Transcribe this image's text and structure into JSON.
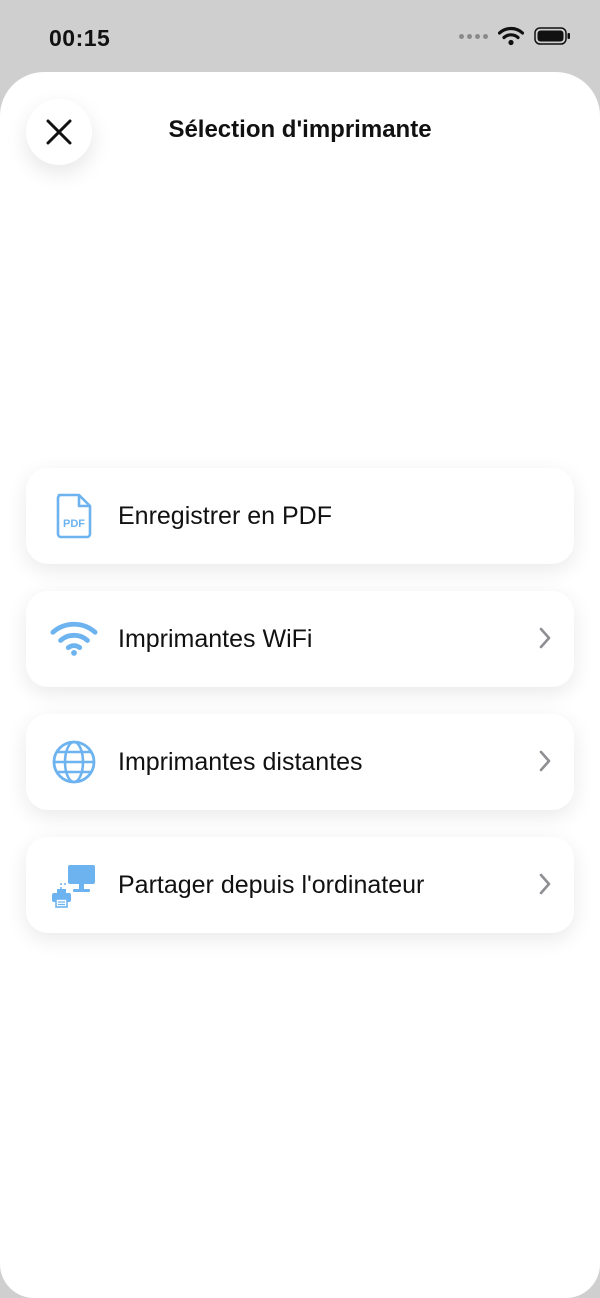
{
  "status_bar": {
    "time": "00:15"
  },
  "sheet": {
    "title": "Sélection d'imprimante",
    "close_icon": "close-icon"
  },
  "menu": {
    "items": [
      {
        "label": "Enregistrer en PDF",
        "icon": "pdf-file-icon",
        "icon_text": "PDF",
        "has_chevron": false
      },
      {
        "label": "Imprimantes WiFi",
        "icon": "wifi-icon",
        "has_chevron": true
      },
      {
        "label": "Imprimantes distantes",
        "icon": "globe-icon",
        "has_chevron": true
      },
      {
        "label": "Partager depuis l'ordinateur",
        "icon": "computer-printer-icon",
        "has_chevron": true
      }
    ]
  },
  "colors": {
    "accent": "#6db3ef",
    "chevron": "#8e8e93",
    "text": "#111111"
  }
}
